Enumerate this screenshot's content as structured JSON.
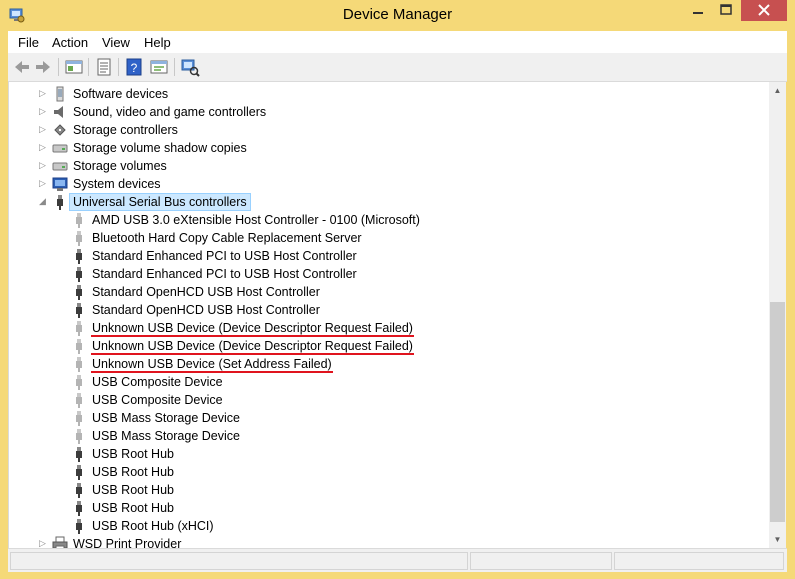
{
  "window": {
    "title": "Device Manager"
  },
  "menu": [
    "File",
    "Action",
    "View",
    "Help"
  ],
  "toolbar": [
    "back",
    "forward",
    "show-hide-console-tree",
    "properties",
    "help",
    "update-driver",
    "scan-hardware"
  ],
  "colors": {
    "frame": "#f5d978",
    "selection_bg": "#cce8ff",
    "selection_border": "#99d1ff",
    "underline": "#e0141e",
    "close": "#c75050"
  },
  "tree": {
    "categories_before": [
      {
        "label": "Software devices",
        "icon": "software-device-icon"
      },
      {
        "label": "Sound, video and game controllers",
        "icon": "speaker-icon"
      },
      {
        "label": "Storage controllers",
        "icon": "storage-controller-icon"
      },
      {
        "label": "Storage volume shadow copies",
        "icon": "storage-volume-icon"
      },
      {
        "label": "Storage volumes",
        "icon": "storage-volume-icon"
      },
      {
        "label": "System devices",
        "icon": "system-device-icon"
      }
    ],
    "expanded_category": {
      "label": "Universal Serial Bus controllers",
      "icon": "usb-plug-icon"
    },
    "usb_devices": [
      {
        "label": "AMD USB 3.0 eXtensible Host Controller - 0100 (Microsoft)",
        "dim": true,
        "underlined": false
      },
      {
        "label": "Bluetooth Hard Copy Cable Replacement Server",
        "dim": true,
        "underlined": false
      },
      {
        "label": "Standard Enhanced PCI to USB Host Controller",
        "dim": false,
        "underlined": false
      },
      {
        "label": "Standard Enhanced PCI to USB Host Controller",
        "dim": false,
        "underlined": false
      },
      {
        "label": "Standard OpenHCD USB Host Controller",
        "dim": false,
        "underlined": false
      },
      {
        "label": "Standard OpenHCD USB Host Controller",
        "dim": false,
        "underlined": false
      },
      {
        "label": "Unknown USB Device (Device Descriptor Request Failed)",
        "dim": true,
        "underlined": true
      },
      {
        "label": "Unknown USB Device (Device Descriptor Request Failed)",
        "dim": true,
        "underlined": true
      },
      {
        "label": "Unknown USB Device (Set Address Failed)",
        "dim": true,
        "underlined": true
      },
      {
        "label": "USB Composite Device",
        "dim": true,
        "underlined": false
      },
      {
        "label": "USB Composite Device",
        "dim": true,
        "underlined": false
      },
      {
        "label": "USB Mass Storage Device",
        "dim": true,
        "underlined": false
      },
      {
        "label": "USB Mass Storage Device",
        "dim": true,
        "underlined": false
      },
      {
        "label": "USB Root Hub",
        "dim": false,
        "underlined": false
      },
      {
        "label": "USB Root Hub",
        "dim": false,
        "underlined": false
      },
      {
        "label": "USB Root Hub",
        "dim": false,
        "underlined": false
      },
      {
        "label": "USB Root Hub",
        "dim": false,
        "underlined": false
      },
      {
        "label": "USB Root Hub (xHCI)",
        "dim": false,
        "underlined": false
      }
    ],
    "categories_after": [
      {
        "label": "WSD Print Provider",
        "icon": "printer-icon"
      }
    ]
  }
}
